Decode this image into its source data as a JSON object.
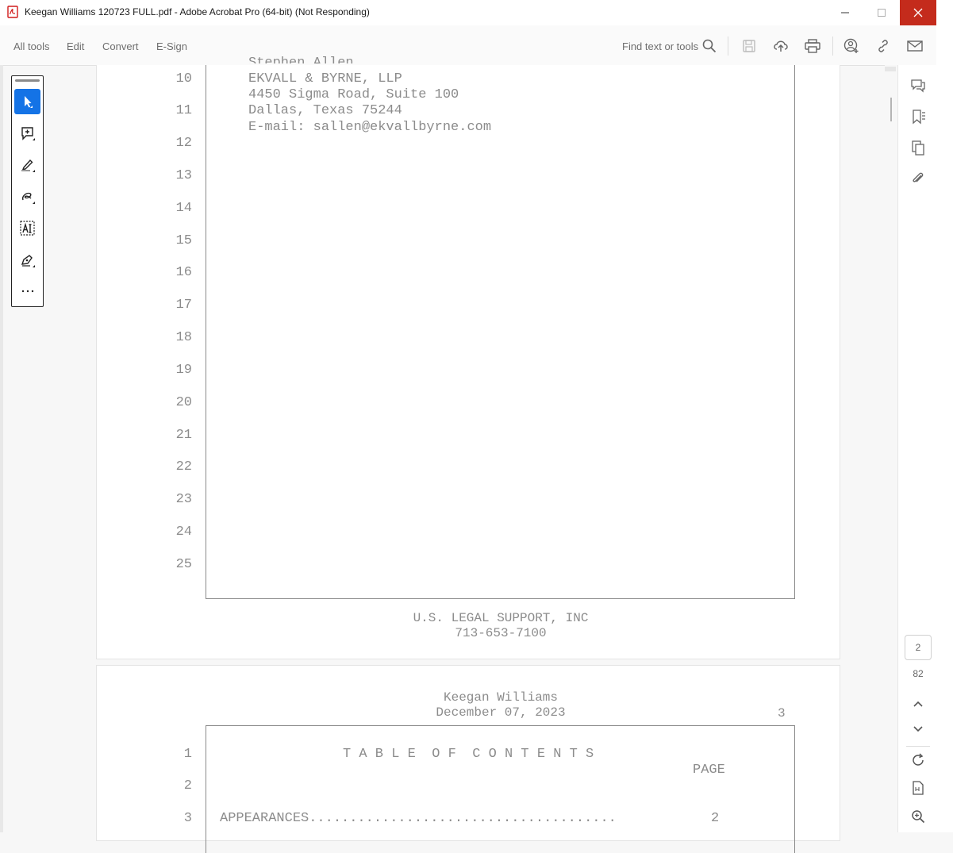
{
  "window": {
    "title": "Keegan Williams 120723 FULL.pdf - Adobe Acrobat Pro (64-bit) (Not Responding)",
    "app_icon": "acrobat-pdf-icon"
  },
  "menu": {
    "all_tools": "All tools",
    "edit": "Edit",
    "convert": "Convert",
    "esign": "E-Sign",
    "find": "Find text or tools"
  },
  "toolbar_icons": [
    "search-icon",
    "save-icon",
    "upload-cloud-icon",
    "print-icon",
    "share-user-icon",
    "link-icon",
    "mail-icon"
  ],
  "tools": [
    "select-pointer-icon",
    "add-comment-icon",
    "highlight-pen-icon",
    "draw-freeform-icon",
    "text-recognition-icon",
    "fill-sign-icon",
    "more-tools-icon"
  ],
  "page1": {
    "address_lines": [
      {
        "num": "10",
        "text": "EKVALL & BYRNE, LLP"
      },
      {
        "num": "",
        "text": "4450 Sigma Road, Suite 100"
      },
      {
        "num": "11",
        "text": "Dallas, Texas  75244"
      },
      {
        "num": "",
        "text": "E-mail: sallen@ekvallbyrne.com"
      }
    ],
    "cut_off_line": "Stephen Allen",
    "line_numbers": [
      "12",
      "13",
      "14",
      "15",
      "16",
      "17",
      "18",
      "19",
      "20",
      "21",
      "22",
      "23",
      "24",
      "25"
    ],
    "footer_company": "U.S. LEGAL SUPPORT, INC",
    "footer_phone": "713-653-7100"
  },
  "page2": {
    "header_name": "Keegan Williams",
    "header_date": "December 07, 2023",
    "page_number": "3",
    "toc_title": "T A B L E  O F  C O N T E N T S",
    "page_col_label": "PAGE",
    "line_numbers": [
      "1",
      "2",
      "3"
    ],
    "entries": [
      {
        "label": "APPEARANCES......................................",
        "page": "2"
      }
    ]
  },
  "sidebar": {
    "icons": [
      "comments-icon",
      "bookmarks-icon",
      "pages-icon",
      "attachments-icon"
    ],
    "current_page": "2",
    "total_pages": "82",
    "nav_icons": [
      "page-up-icon",
      "page-down-icon",
      "refresh-icon",
      "fit-page-icon",
      "zoom-in-icon"
    ]
  }
}
